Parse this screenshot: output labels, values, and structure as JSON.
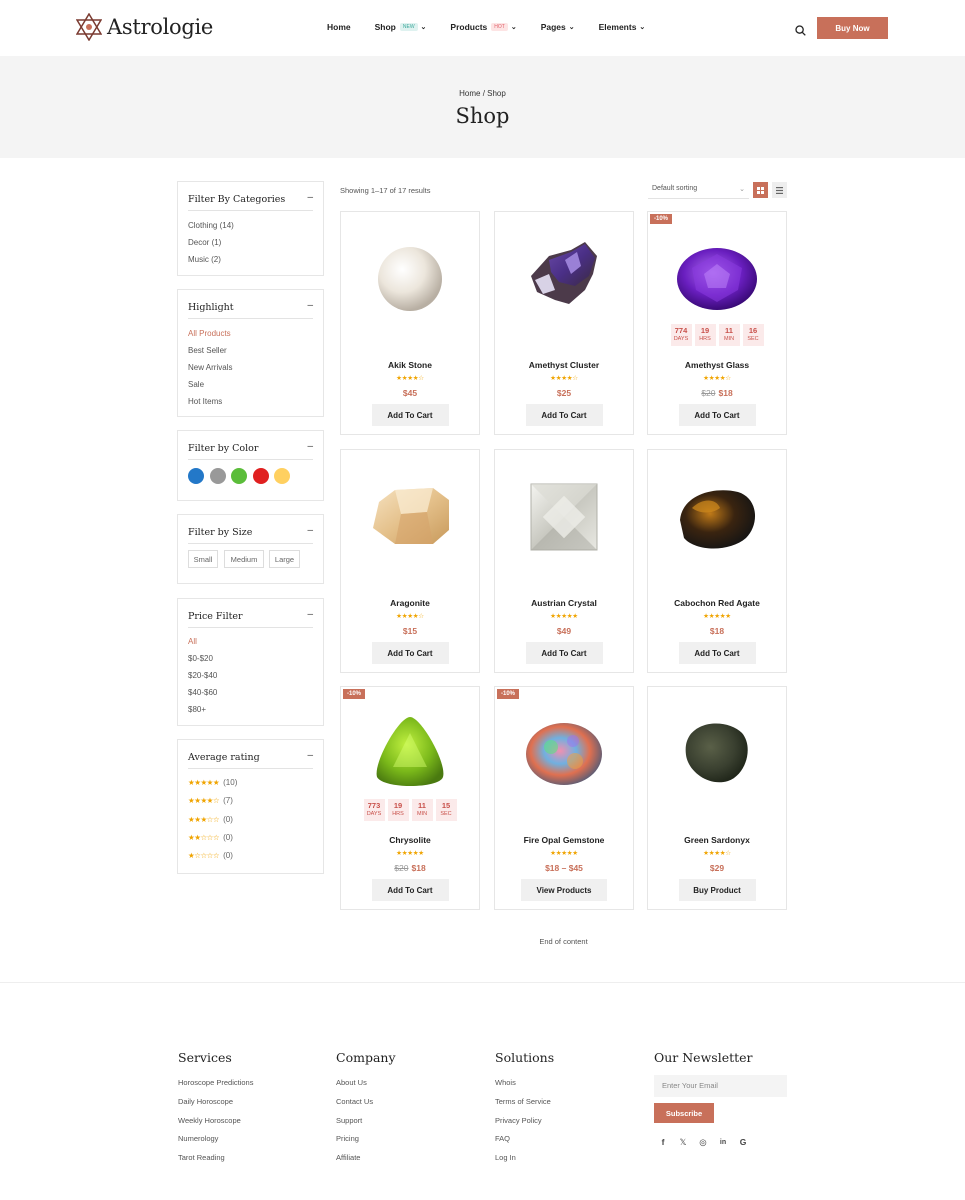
{
  "header": {
    "brand": "Astrologie",
    "nav": [
      {
        "label": "Home",
        "tag": "",
        "chevron": false
      },
      {
        "label": "Shop",
        "tag": "NEW",
        "chevron": true
      },
      {
        "label": "Products",
        "tag": "HOT",
        "chevron": true
      },
      {
        "label": "Pages",
        "tag": "",
        "chevron": true
      },
      {
        "label": "Elements",
        "tag": "",
        "chevron": true
      }
    ],
    "buy_now": "Buy Now"
  },
  "banner": {
    "breadcrumb": "Home / Shop",
    "title": "Shop"
  },
  "sidebar": {
    "categories": {
      "title": "Filter By Categories",
      "items": [
        "Clothing (14)",
        "Decor (1)",
        "Music (2)"
      ]
    },
    "highlight": {
      "title": "Highlight",
      "items": [
        "All Products",
        "Best Seller",
        "New Arrivals",
        "Sale",
        "Hot Items"
      ],
      "active": 0
    },
    "color": {
      "title": "Filter by Color",
      "swatches": [
        "#2378c8",
        "#999999",
        "#5bbd3a",
        "#e02020",
        "#ffd060"
      ]
    },
    "size": {
      "title": "Filter by Size",
      "options": [
        "Small",
        "Medium",
        "Large"
      ]
    },
    "price": {
      "title": "Price Filter",
      "items": [
        "All",
        "$0-$20",
        "$20-$40",
        "$40-$60",
        "$80+"
      ],
      "active": 0
    },
    "rating": {
      "title": "Average rating",
      "items": [
        {
          "stars": 5,
          "count": "(10)"
        },
        {
          "stars": 4,
          "count": "(7)"
        },
        {
          "stars": 3,
          "count": "(0)"
        },
        {
          "stars": 2,
          "count": "(0)"
        },
        {
          "stars": 1,
          "count": "(0)"
        }
      ]
    }
  },
  "toolbar": {
    "showing": "Showing 1–17 of 17 results",
    "sort": "Default sorting"
  },
  "products": [
    {
      "name": "Akik Stone",
      "rating": 4,
      "old_price": "",
      "price": "$45",
      "button": "Add To Cart",
      "sale": "",
      "countdown": null,
      "gem": "pearl"
    },
    {
      "name": "Amethyst Cluster",
      "rating": 4,
      "old_price": "",
      "price": "$25",
      "button": "Add To Cart",
      "sale": "",
      "countdown": null,
      "gem": "cluster"
    },
    {
      "name": "Amethyst Glass",
      "rating": 4,
      "old_price": "$20",
      "price": "$18",
      "button": "Add To Cart",
      "sale": "-10%",
      "countdown": [
        {
          "v": "774",
          "l": "DAYS"
        },
        {
          "v": "19",
          "l": "HRS"
        },
        {
          "v": "11",
          "l": "MIN"
        },
        {
          "v": "16",
          "l": "SEC"
        }
      ],
      "gem": "amethyst"
    },
    {
      "name": "Aragonite",
      "rating": 4,
      "old_price": "",
      "price": "$15",
      "button": "Add To Cart",
      "sale": "",
      "countdown": null,
      "gem": "aragonite"
    },
    {
      "name": "Austrian Crystal",
      "rating": 5,
      "old_price": "",
      "price": "$49",
      "button": "Add To Cart",
      "sale": "",
      "countdown": null,
      "gem": "crystal"
    },
    {
      "name": "Cabochon Red Agate",
      "rating": 4.5,
      "old_price": "",
      "price": "$18",
      "button": "Add To Cart",
      "sale": "",
      "countdown": null,
      "gem": "agate"
    },
    {
      "name": "Chrysolite",
      "rating": 5,
      "old_price": "$20",
      "price": "$18",
      "button": "Add To Cart",
      "sale": "-10%",
      "countdown": [
        {
          "v": "773",
          "l": "DAYS"
        },
        {
          "v": "19",
          "l": "HRS"
        },
        {
          "v": "11",
          "l": "MIN"
        },
        {
          "v": "15",
          "l": "SEC"
        }
      ],
      "gem": "chrysolite"
    },
    {
      "name": "Fire Opal Gemstone",
      "rating": 5,
      "old_price": "",
      "price": "$18 – $45",
      "button": "View Products",
      "sale": "-10%",
      "countdown": null,
      "gem": "opal"
    },
    {
      "name": "Green Sardonyx",
      "rating": 4,
      "old_price": "",
      "price": "$29",
      "button": "Buy Product",
      "sale": "",
      "countdown": null,
      "gem": "sardonyx"
    }
  ],
  "end_of_content": "End of content",
  "footer": {
    "services": {
      "title": "Services",
      "links": [
        "Horoscope Predictions",
        "Daily Horoscope",
        "Weekly Horoscope",
        "Numerology",
        "Tarot Reading"
      ]
    },
    "company": {
      "title": "Company",
      "links": [
        "About Us",
        "Contact Us",
        "Support",
        "Pricing",
        "Affiliate"
      ]
    },
    "solutions": {
      "title": "Solutions",
      "links": [
        "Whois",
        "Terms of Service",
        "Privacy Policy",
        "FAQ",
        "Log In"
      ]
    },
    "newsletter": {
      "title": "Our Newsletter",
      "placeholder": "Enter Your Email",
      "button": "Subscribe",
      "social": [
        "facebook-icon",
        "x-icon",
        "instagram-icon",
        "linkedin-icon",
        "google-icon"
      ]
    }
  },
  "colors": {
    "accent": "#c8705a",
    "star": "#f0a400",
    "banner_bg": "#f4f4f4"
  }
}
